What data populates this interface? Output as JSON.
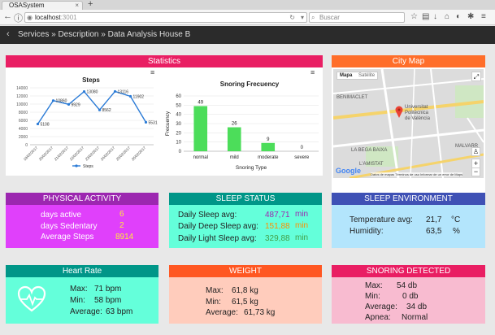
{
  "browser": {
    "tab_title": "OSASystem",
    "tab_close": "×",
    "new_tab": "+",
    "url_host": "localhost",
    "url_port": ":3001",
    "search_placeholder": "Buscar"
  },
  "breadcrumb": "Services » Description » Data Analysis House B",
  "statistics": {
    "title": "Statistics",
    "header_color": "#e91e63",
    "steps_chart": {
      "type": "line",
      "title": "Steps",
      "categories": [
        "19/02/2017",
        "20/02/2017",
        "21/02/2017",
        "22/02/2017",
        "23/02/2017",
        "24/02/2017",
        "25/02/2017",
        "26/02/2017"
      ],
      "values": [
        5108,
        10860,
        9929,
        13080,
        8562,
        13116,
        11902,
        5531
      ],
      "ylim": [
        0,
        14000
      ],
      "yticks": [
        "0",
        "2000",
        "4000",
        "6000",
        "8000",
        "10000",
        "12000",
        "14000"
      ],
      "legend": "Steps",
      "color": "#2b7bd6"
    },
    "snoring_chart": {
      "type": "bar",
      "title": "Snoring Frecuency",
      "categories": [
        "normal",
        "mild",
        "moderate",
        "severe"
      ],
      "values": [
        49,
        26,
        9,
        0
      ],
      "ylim": [
        0,
        60
      ],
      "yticks": [
        "0",
        "10",
        "20",
        "30",
        "40",
        "50",
        "60"
      ],
      "xlabel": "Snoring Type",
      "ylabel": "Frecuency",
      "color": "#4cdd5a"
    }
  },
  "city_map": {
    "title": "City Map",
    "header_color": "#ff6e2a",
    "map_tab": "Mapa",
    "satellite_tab": "Satélite",
    "labels": [
      "BENIMACLET",
      "Universitat",
      "Politècnica",
      "de València",
      "LA BEGA BAIXA",
      "L'AMISTAT",
      "MALVARR"
    ],
    "google": "Google",
    "footer": "Datos de mapas   Términos de uso   Informar de un error de Maps"
  },
  "physical_activity": {
    "title": "PHYSICAL ACTIVITY",
    "header_color": "#9c27b0",
    "body_color": "#e040fb",
    "rows": [
      {
        "label": "days active",
        "value": "6"
      },
      {
        "label": "days Sedentary",
        "value": "2"
      },
      {
        "label": "Average Steps",
        "value": "8914"
      }
    ]
  },
  "sleep_status": {
    "title": "SLEEP STATUS",
    "header_color": "#009688",
    "body_color": "#64ffda",
    "rows": [
      {
        "label": "Daily Sleep avg:",
        "value": "487,71",
        "unit": "min",
        "color": "#9c27b0"
      },
      {
        "label": "Daily Deep Sleep avg:",
        "value": "151,88",
        "unit": "min",
        "color": "#ff8f00"
      },
      {
        "label": "Daily Light Sleep avg:",
        "value": "329,88",
        "unit": "min",
        "color": "#43a047"
      }
    ]
  },
  "sleep_environment": {
    "title": "SLEEP ENVIRONMENT",
    "header_color": "#3f51b5",
    "body_color": "#b3e5fc",
    "rows": [
      {
        "label": "Temperature avg:",
        "value": "21,7",
        "unit": "°C"
      },
      {
        "label": "Humidity:",
        "value": "63,5",
        "unit": "%"
      }
    ]
  },
  "heart_rate": {
    "title": "Heart Rate",
    "header_color": "#009688",
    "body_color": "#64ffda",
    "rows": [
      {
        "label": "Max:",
        "value": "71  bpm"
      },
      {
        "label": "Min:",
        "value": "58  bpm"
      },
      {
        "label": "Average:",
        "value": "63 bpm"
      }
    ]
  },
  "weight": {
    "title": "WEIGHT",
    "header_color": "#ff5722",
    "body_color": "#ffccbc",
    "rows": [
      {
        "label": "Max:",
        "value": "61,8  kg"
      },
      {
        "label": "Min:",
        "value": "61,5  kg"
      },
      {
        "label": "Average:",
        "value": "61,73 kg"
      }
    ]
  },
  "snoring_detected": {
    "title": "SNORING DETECTED",
    "header_color": "#e91e63",
    "body_color": "#f8bbd0",
    "rows": [
      {
        "label": "Max:",
        "value": "54 db"
      },
      {
        "label": "Min:",
        "value": "0 db"
      },
      {
        "label": "Average:",
        "value": "34 db"
      },
      {
        "label": "Apnea:",
        "value": "Normal"
      }
    ]
  }
}
